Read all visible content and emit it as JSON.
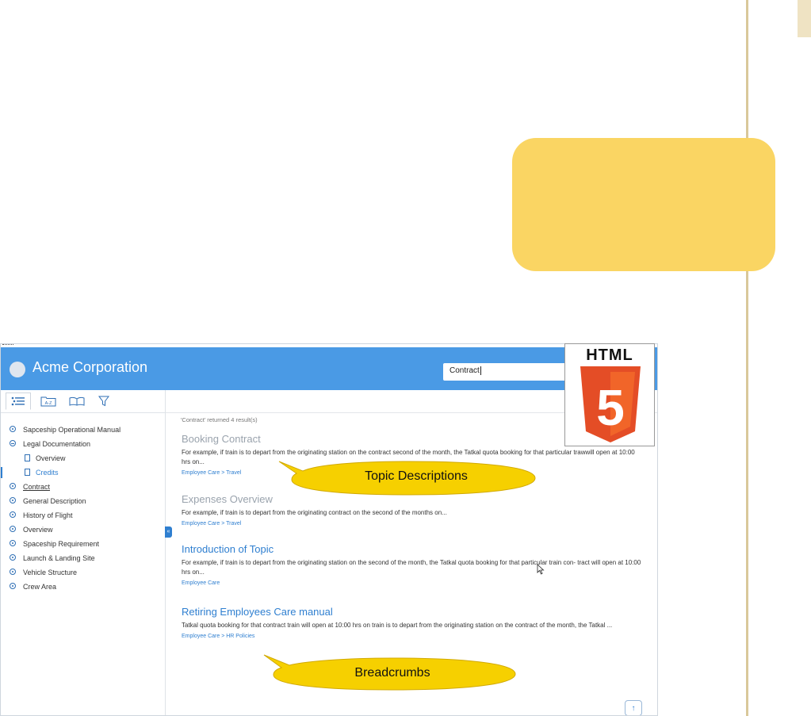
{
  "app": {
    "title": "Acme Corporation",
    "search_value": "Contract"
  },
  "sidebar": {
    "tabs": [
      {
        "icon": "toc-list-icon"
      },
      {
        "icon": "index-az-icon",
        "label": "A-Z"
      },
      {
        "icon": "glossary-book-icon"
      },
      {
        "icon": "filter-icon"
      }
    ],
    "items": [
      {
        "label": "Sapceship Operational Manual"
      },
      {
        "label": "Legal Documentation"
      },
      {
        "label": "Overview"
      },
      {
        "label": "Credits"
      },
      {
        "label": "Contract"
      },
      {
        "label": "General Description"
      },
      {
        "label": "History of Flight"
      },
      {
        "label": "Overview"
      },
      {
        "label": "Spaceship Requirement"
      },
      {
        "label": "Launch & Landing Site"
      },
      {
        "label": "Vehicle Structure"
      },
      {
        "label": "Crew Area"
      }
    ],
    "collapse_label": "«"
  },
  "results": {
    "count_text": "'Contract' returned 4 result(s)",
    "items": [
      {
        "title": "Booking Contract",
        "desc": "For example, if train is to depart from the originating station on the contract second of the month, the Tatkal quota booking for that particular trawwill open at 10:00 hrs on...",
        "crumb": "Employee Care > Travel"
      },
      {
        "title": "Expenses Overview",
        "desc": "For example, if train is to depart from the originating contract on the second of the months on...",
        "crumb": "Employee Care > Travel"
      },
      {
        "title": "Introduction of Topic",
        "desc": "For example, if train is to depart from the originating station on the second of the month, the Tatkal quota booking for that particular train con- tract will open at 10:00 hrs on...",
        "crumb": "Employee Care"
      },
      {
        "title": "Retiring Employees Care manual",
        "desc": "Tatkal quota booking for that contract train will open at 10:00 hrs on train is to depart from the originating station on the contract of the month, the Tatkal ...",
        "crumb": "Employee Care > HR Policies"
      }
    ],
    "to_top_label": "↑"
  },
  "logo": {
    "word": "HTML",
    "numeral": "5"
  },
  "callouts": {
    "topic_descriptions": "Topic Descriptions",
    "breadcrumbs": "Breadcrumbs"
  },
  "colors": {
    "header_blue": "#4a9ae5",
    "link_blue": "#2f7fd0",
    "callout_yellow": "#fad563",
    "bubble_yellow": "#f6d000",
    "html5_orange": "#e44d26"
  }
}
